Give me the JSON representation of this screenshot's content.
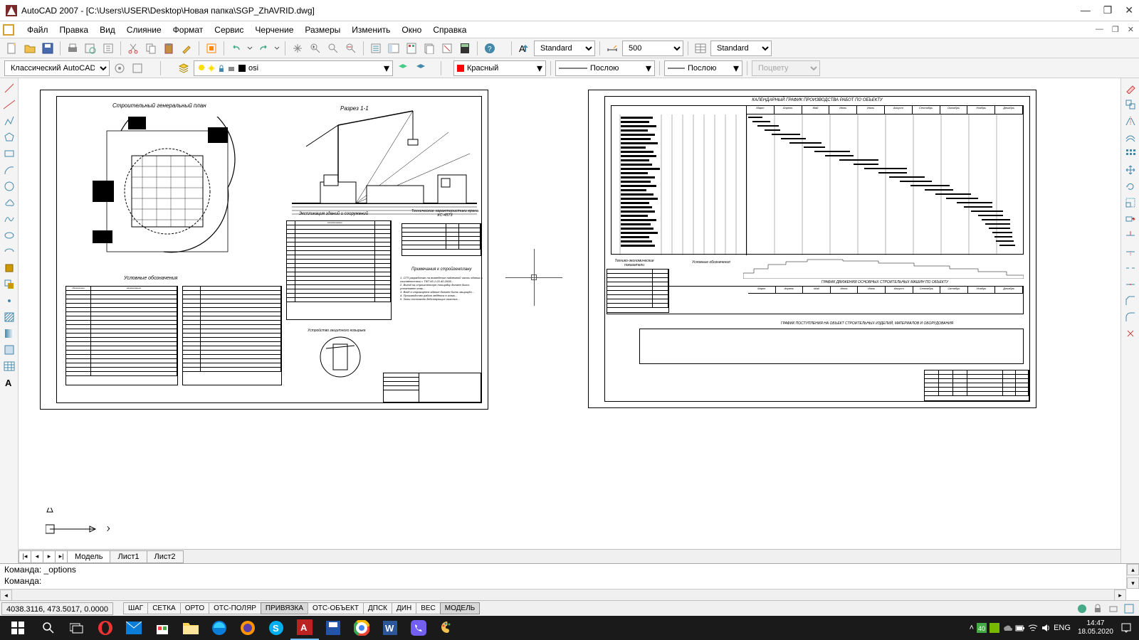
{
  "titlebar": {
    "text": "AutoCAD 2007 - [C:\\Users\\USER\\Desktop\\Новая папка\\SGP_ZhAVRID.dwg]"
  },
  "menus": [
    "Файл",
    "Правка",
    "Вид",
    "Слияние",
    "Формат",
    "Сервис",
    "Черчение",
    "Размеры",
    "Изменить",
    "Окно",
    "Справка"
  ],
  "toolbar1": {
    "text_style": "Standard",
    "dim_scale": "500",
    "table_style": "Standard"
  },
  "toolbar2": {
    "workspace": "Классический AutoCAD",
    "layer": "osi",
    "color": "Красный",
    "linetype": "Послою",
    "lineweight": "Послою",
    "plot": "Поцвету"
  },
  "tabs": {
    "items": [
      "Модель",
      "Лист1",
      "Лист2"
    ],
    "active": 0
  },
  "command": {
    "line1": "Команда: _options",
    "line2": "Команда:"
  },
  "status": {
    "coords": "4038.3116, 473.5017, 0.0000",
    "toggles": [
      "ШАГ",
      "СЕТКА",
      "ОРТО",
      "ОТС-ПОЛЯР",
      "ПРИВЯЗКА",
      "ОТС-ОБЪЕКТ",
      "ДПСК",
      "ДИН",
      "ВЕС",
      "МОДЕЛЬ"
    ]
  },
  "taskbar": {
    "lang": "ENG",
    "time": "14:47",
    "date": "18.05.2020"
  },
  "drawing": {
    "sheet1": {
      "main_title": "Строительный генеральный план",
      "section": "Разрез 1-1",
      "legend": "Условные обозначения",
      "explication": "Экспликация зданий и сооружений",
      "crane_specs": "Технические характеристики крана КС-4573",
      "notes": "Примечания к стройгенплану",
      "device": "Устройство защитного козырька"
    },
    "sheet2": {
      "gantt_title": "КАЛЕНДАРНЫЙ ГРАФИК ПРОИЗВОДСТВА РАБОТ ПО ОБЪЕКТУ",
      "months": [
        "Март",
        "Апрель",
        "Май",
        "Июнь",
        "Июль",
        "Август",
        "Сентябрь",
        "Октябрь",
        "Ноябрь",
        "Декабрь"
      ],
      "indicators": "Технико-экономические показатели",
      "legend2": "Условные обозначения",
      "machines": "ГРАФИК ДВИЖЕНИЯ ОСНОВНЫХ СТРОИТЕЛЬНЫХ МАШИН ПО ОБЪЕКТУ",
      "materials": "ГРАФИК ПОСТУПЛЕНИЯ НА ОБЪЕКТ СТРОИТЕЛЬНЫХ ИЗДЕЛИЙ, МАТЕРИАЛОВ И ОБОРУДОВАНИЯ"
    }
  }
}
